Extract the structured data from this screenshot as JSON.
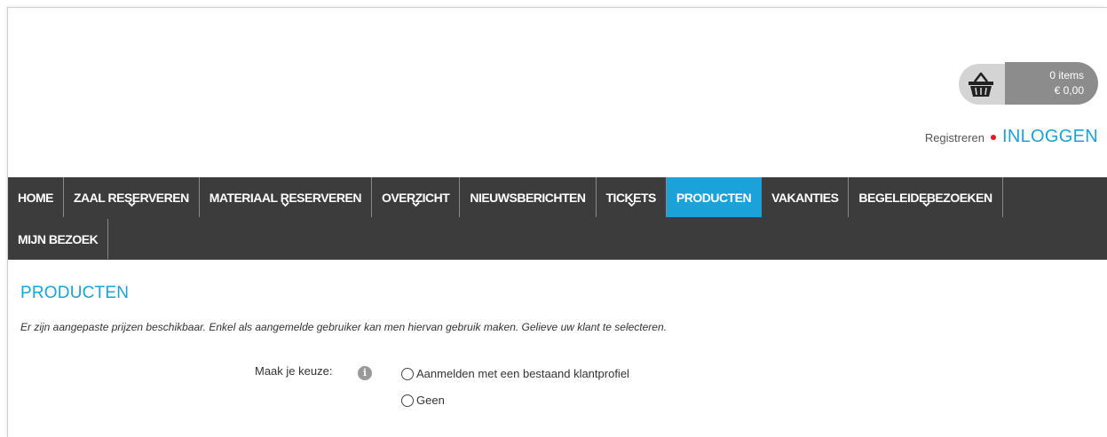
{
  "cart": {
    "items": "0 items",
    "total": "€ 0,00",
    "icon": "basket-icon"
  },
  "auth": {
    "register": "Registreren",
    "login": "INLOGGEN"
  },
  "nav": {
    "row1": [
      {
        "label": "HOME",
        "dropdown": false
      },
      {
        "label": "ZAAL RESERVEREN",
        "dropdown": true
      },
      {
        "label": "MATERIAAL RESERVEREN",
        "dropdown": true
      },
      {
        "label": "OVERZICHT",
        "dropdown": true
      },
      {
        "label": "NIEUWSBERICHTEN",
        "dropdown": false
      },
      {
        "label": "TICKETS",
        "dropdown": true
      },
      {
        "label": "PRODUCTEN",
        "dropdown": false,
        "active": true
      },
      {
        "label": "VAKANTIES",
        "dropdown": false
      },
      {
        "label": "BEGELEIDEBEZOEKEN",
        "dropdown": true
      }
    ],
    "row2": [
      {
        "label": "MIJN BEZOEK",
        "dropdown": false
      }
    ]
  },
  "main": {
    "title": "PRODUCTEN",
    "notice": "Er zijn aangepaste prijzen beschikbaar. Enkel als aangemelde gebruiker kan men hiervan gebruik maken. Gelieve uw klant te selecteren.",
    "choice_label": "Maak je keuze:",
    "info_icon": "i",
    "options": [
      {
        "label": "Aanmelden met een bestaand klantprofiel",
        "selected": false
      },
      {
        "label": "Geen",
        "selected": false
      }
    ]
  },
  "colors": {
    "accent": "#1aa2d9",
    "nav_bg": "#3c3c3c",
    "dot": "#e8171b"
  }
}
